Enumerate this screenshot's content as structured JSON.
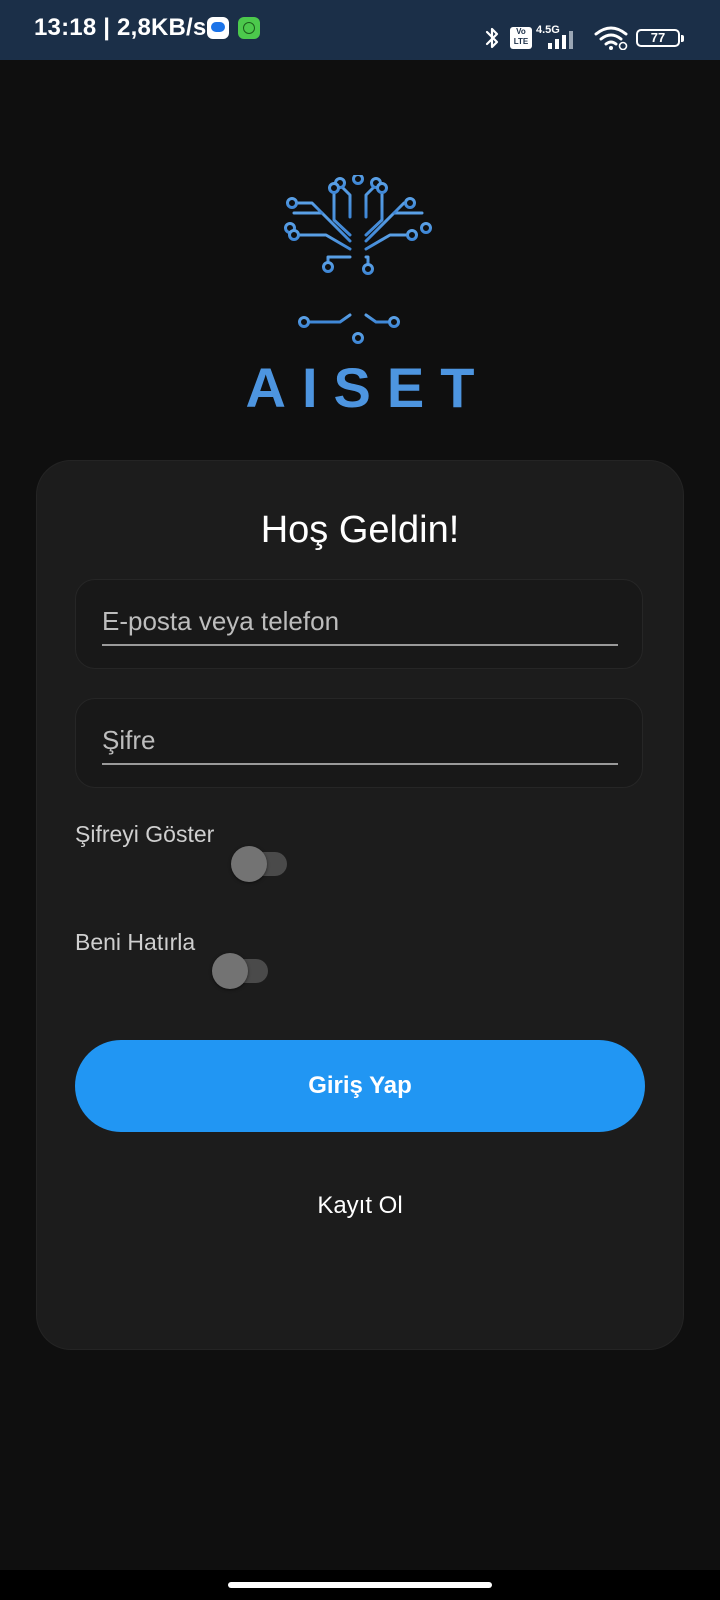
{
  "status_bar": {
    "time_speed": "13:18 | 2,8KB/s",
    "volte": "Vo LTE",
    "network": "4.5G",
    "battery": "77"
  },
  "brand": {
    "name": "AISET",
    "color": "#4d95e0",
    "icon": "circuit-tree-logo"
  },
  "login": {
    "title": "Hoş Geldin!",
    "email_placeholder": "E-posta veya telefon",
    "email_value": "",
    "password_placeholder": "Şifre",
    "password_value": "",
    "show_password_label": "Şifreyi Göster",
    "show_password_on": false,
    "remember_me_label": "Beni Hatırla",
    "remember_me_on": false,
    "login_button": "Giriş Yap",
    "register_link": "Kayıt Ol",
    "accent_color": "#2196f3"
  }
}
